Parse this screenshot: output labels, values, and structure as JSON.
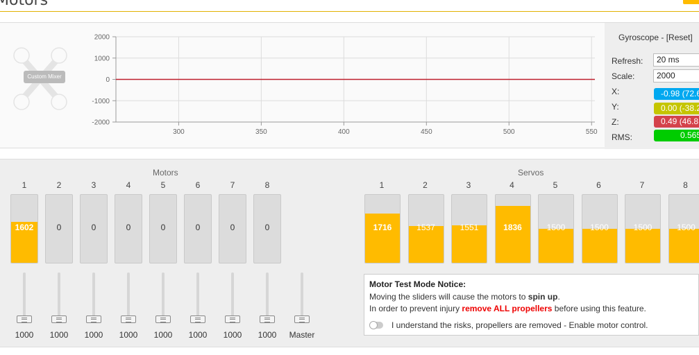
{
  "header": {
    "title": "Motors"
  },
  "mixer": {
    "label": "Custom Mixer"
  },
  "chart_data": {
    "type": "line",
    "x_ticks": [
      "300",
      "350",
      "400",
      "450",
      "500",
      "550"
    ],
    "y_ticks": [
      "2000",
      "1000",
      "0",
      "-1000",
      "-2000"
    ],
    "xlim": [
      262,
      552
    ],
    "ylim": [
      -2000,
      2000
    ],
    "series": [
      {
        "color": "#be1e2d",
        "x": [
          262,
          552
        ],
        "values": [
          0,
          0
        ]
      }
    ],
    "grid": true
  },
  "gyro": {
    "title": "Gyroscope - [Reset]",
    "refresh_label": "Refresh:",
    "refresh_value": "20 ms",
    "scale_label": "Scale:",
    "scale_value": "2000",
    "x_label": "X:",
    "x_value": "-0.98 (72.6",
    "y_label": "Y:",
    "y_value": "0.00 (-38.2",
    "z_label": "Z:",
    "z_value": "0.49 (46.8",
    "rms_label": "RMS:",
    "rms_value": "0.565",
    "colors": {
      "x": "#00a8f0",
      "y": "#c5c500",
      "z": "#d4424b",
      "rms": "#00cc00"
    }
  },
  "motors": {
    "title": "Motors",
    "items": [
      {
        "index": "1",
        "value": "1602",
        "fill": 0.6,
        "slider": "1000"
      },
      {
        "index": "2",
        "value": "0",
        "fill": 0,
        "slider": "1000"
      },
      {
        "index": "3",
        "value": "0",
        "fill": 0,
        "slider": "1000"
      },
      {
        "index": "4",
        "value": "0",
        "fill": 0,
        "slider": "1000"
      },
      {
        "index": "5",
        "value": "0",
        "fill": 0,
        "slider": "1000"
      },
      {
        "index": "6",
        "value": "0",
        "fill": 0,
        "slider": "1000"
      },
      {
        "index": "7",
        "value": "0",
        "fill": 0,
        "slider": "1000"
      },
      {
        "index": "8",
        "value": "0",
        "fill": 0,
        "slider": "1000"
      }
    ],
    "master_label": "Master"
  },
  "servos": {
    "title": "Servos",
    "items": [
      {
        "index": "1",
        "value": "1716",
        "fill": 0.72
      },
      {
        "index": "2",
        "value": "1537",
        "fill": 0.54
      },
      {
        "index": "3",
        "value": "1551",
        "fill": 0.55
      },
      {
        "index": "4",
        "value": "1836",
        "fill": 0.84
      },
      {
        "index": "5",
        "value": "1500",
        "fill": 0.5
      },
      {
        "index": "6",
        "value": "1500",
        "fill": 0.5
      },
      {
        "index": "7",
        "value": "1500",
        "fill": 0.5
      },
      {
        "index": "8",
        "value": "1500",
        "fill": 0.5
      }
    ]
  },
  "notice": {
    "title": "Motor Test Mode Notice:",
    "line1_pre": "Moving the sliders will cause the motors to ",
    "line1_bold": "spin up",
    "line1_post": ".",
    "line2_pre": "In order to prevent injury ",
    "line2_red": "remove ALL propellers",
    "line2_post": " before using this feature.",
    "toggle_label": "I understand the risks, propellers are removed - Enable motor control."
  }
}
